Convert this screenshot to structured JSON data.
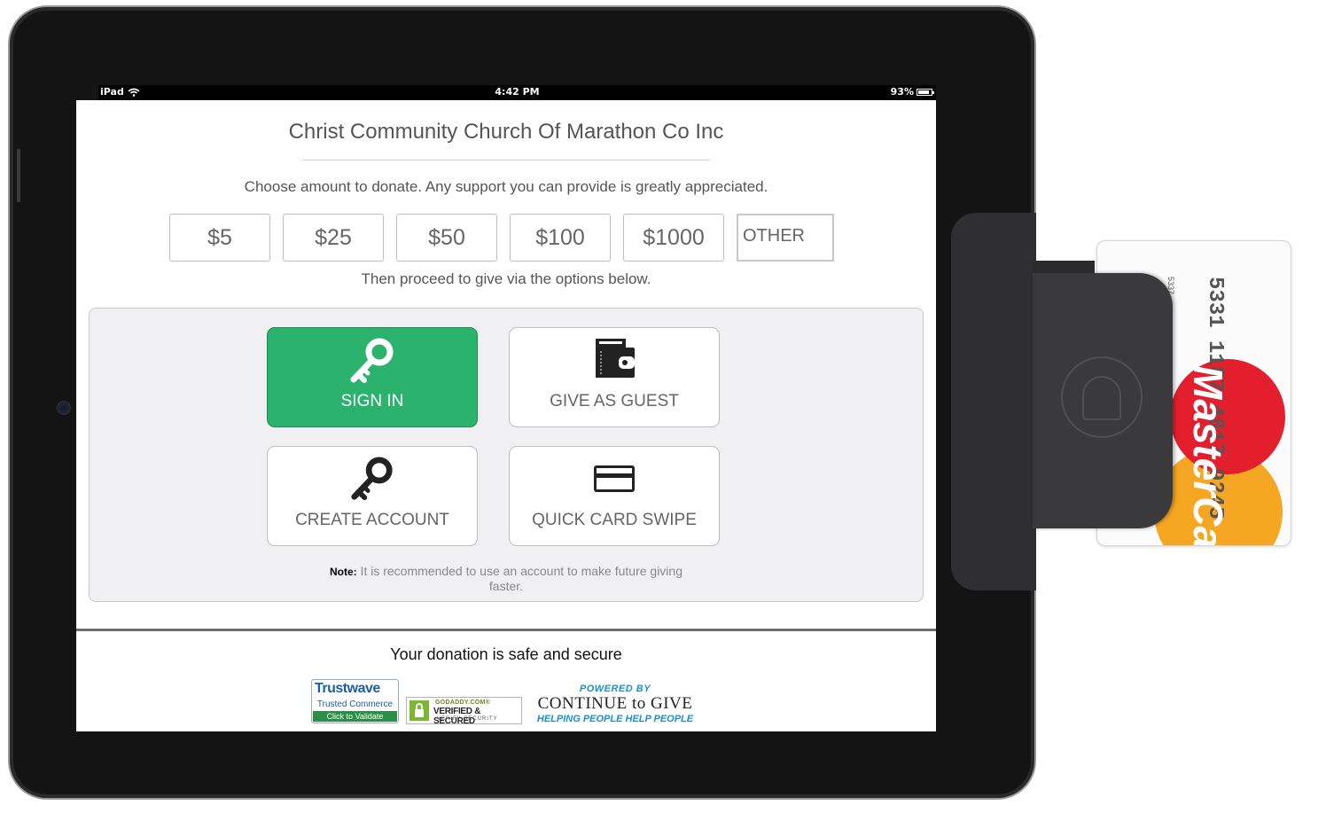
{
  "status_bar": {
    "device": "iPad",
    "time": "4:42 PM",
    "battery": "93%"
  },
  "org_title": "Christ Community Church Of Marathon Co Inc",
  "instruction": "Choose amount to donate. Any support you can provide is greatly appreciated.",
  "amounts": [
    "$5",
    "$25",
    "$50",
    "$100",
    "$1000"
  ],
  "other_placeholder": "OTHER",
  "proceed_text": "Then proceed to give via the options below.",
  "options": {
    "sign_in": {
      "label": "SIGN IN",
      "icon": "key-icon"
    },
    "guest": {
      "label": "GIVE AS GUEST",
      "icon": "wallet-icon"
    },
    "create": {
      "label": "CREATE ACCOUNT",
      "icon": "key-icon"
    },
    "swipe": {
      "label": "QUICK CARD SWIPE",
      "icon": "credit-card-icon"
    }
  },
  "note": {
    "prefix": "Note:",
    "text": " It is recommended to use an account to make future giving faster."
  },
  "footer": {
    "safe_text": "Your donation is safe and secure",
    "trustwave": {
      "name": "Trustwave",
      "sub": "Trusted Commerce",
      "button": "Click to Validate"
    },
    "godaddy": {
      "top": "GODADDY.COM®",
      "main": "VERIFIED & SECURED",
      "bottom": "VERIFY SECURITY"
    },
    "continue_to_give": {
      "powered": "POWERED BY",
      "name": "CONTINUE to GIVE",
      "tagline": "HELPING PEOPLE HELP PEOPLE"
    }
  },
  "card": {
    "brand": "MasterCard",
    "number": "5331 1187 4817 9245",
    "small": "5337"
  },
  "colors": {
    "accent_green": "#2bb36e",
    "frame": "#141414",
    "mastercard_red": "#e31e2d",
    "mastercard_yellow": "#f5a623"
  }
}
